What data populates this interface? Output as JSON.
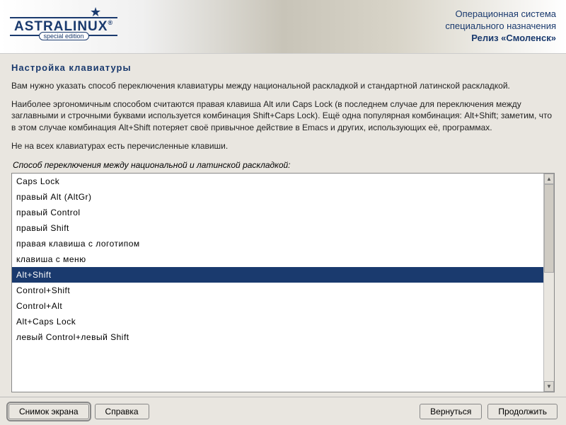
{
  "header": {
    "logo_name": "ASTRALINUX",
    "logo_sub": "special edition",
    "os_line1": "Операционная система",
    "os_line2": "специального назначения",
    "release": "Релиз «Смоленск»"
  },
  "section_title": "Настройка клавиатуры",
  "description": {
    "p1": "Вам нужно указать способ переключения клавиатуры между национальной раскладкой и стандартной латинской раскладкой.",
    "p2": "Наиболее эргономичным способом считаются правая клавиша Alt или Caps Lock (в последнем случае для переключения между заглавными и строчными буквами используется комбинация Shift+Caps Lock). Ещё одна популярная комбинация: Alt+Shift; заметим, что в этом случае комбинация Alt+Shift потеряет своё привычное действие в Emacs и других, использующих её, программах.",
    "p3": "Не на всех клавиатурах есть перечисленные клавиши."
  },
  "prompt_label": "Способ переключения между национальной и латинской раскладкой:",
  "list": {
    "items": [
      "Caps Lock",
      "правый Alt (AltGr)",
      "правый Control",
      "правый Shift",
      "правая клавиша с логотипом",
      "клавиша с меню",
      "Alt+Shift",
      "Control+Shift",
      "Control+Alt",
      "Alt+Caps Lock",
      "левый Control+левый Shift"
    ],
    "selected_index": 6
  },
  "footer": {
    "screenshot": "Снимок экрана",
    "help": "Справка",
    "back": "Вернуться",
    "continue": "Продолжить"
  }
}
